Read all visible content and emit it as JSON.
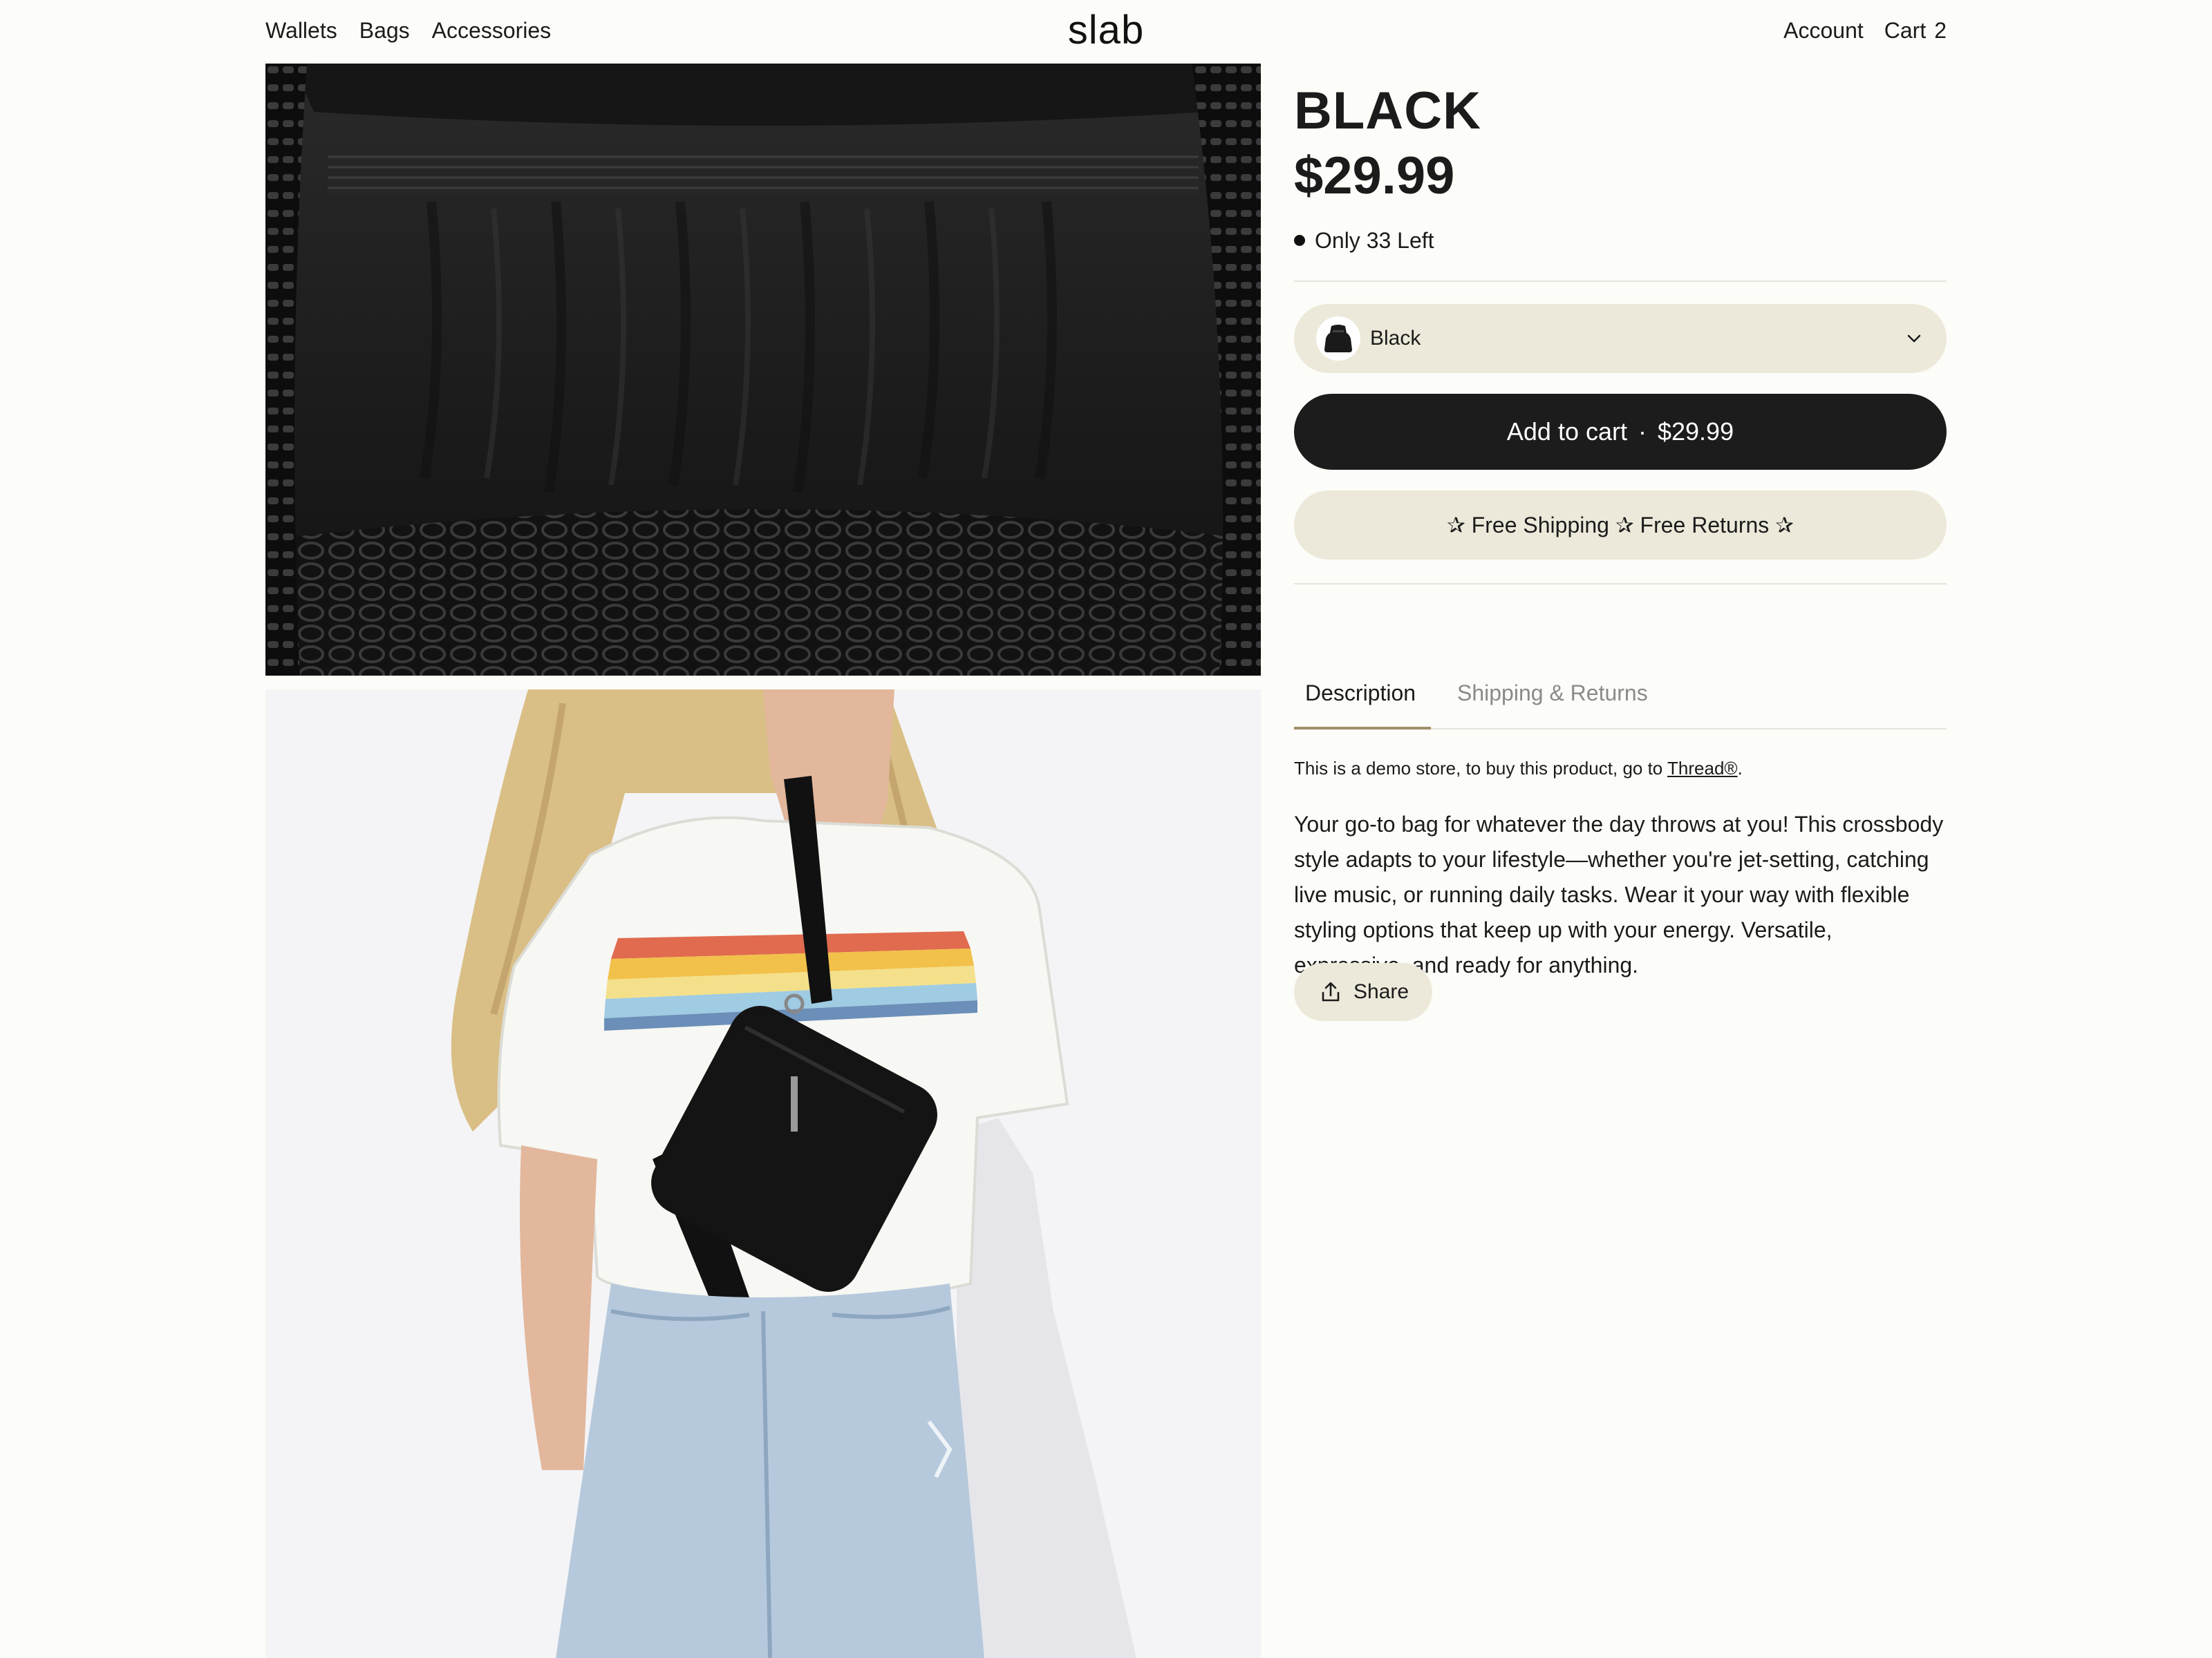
{
  "header": {
    "nav": [
      "Wallets",
      "Bags",
      "Accessories"
    ],
    "logo": "slab",
    "account": "Account",
    "cart_label": "Cart",
    "cart_count": "2"
  },
  "product": {
    "title": "BLACK",
    "price": "$29.99",
    "stock": "Only 33 Left",
    "variant": "Black",
    "add_to_cart": "Add to cart",
    "add_to_cart_separator": "·",
    "add_to_cart_price": "$29.99",
    "promo": "✰ Free Shipping ✰ Free Returns ✰"
  },
  "tabs": [
    "Description",
    "Shipping & Returns"
  ],
  "content": {
    "demo_prefix": "This is a demo store, to buy this product, go to ",
    "demo_link": "Thread®",
    "demo_suffix": ".",
    "description": "Your go-to bag for whatever the day throws at you! This crossbody style adapts to your lifestyle—whether you're jet-setting, catching live music, or running daily tasks. Wear it your way with flexible styling options that keep up with your energy. Versatile, expressive, and ready for anything.",
    "share": "Share"
  },
  "colors": {
    "background": "#fcfcf8",
    "pill": "#ece9da",
    "primary_button": "#1c1c1c",
    "tab_accent": "#a38f6c"
  },
  "icons": {
    "variant_swatch": "bag-thumbnail",
    "dropdown": "chevron-down-icon",
    "share": "share-icon"
  }
}
